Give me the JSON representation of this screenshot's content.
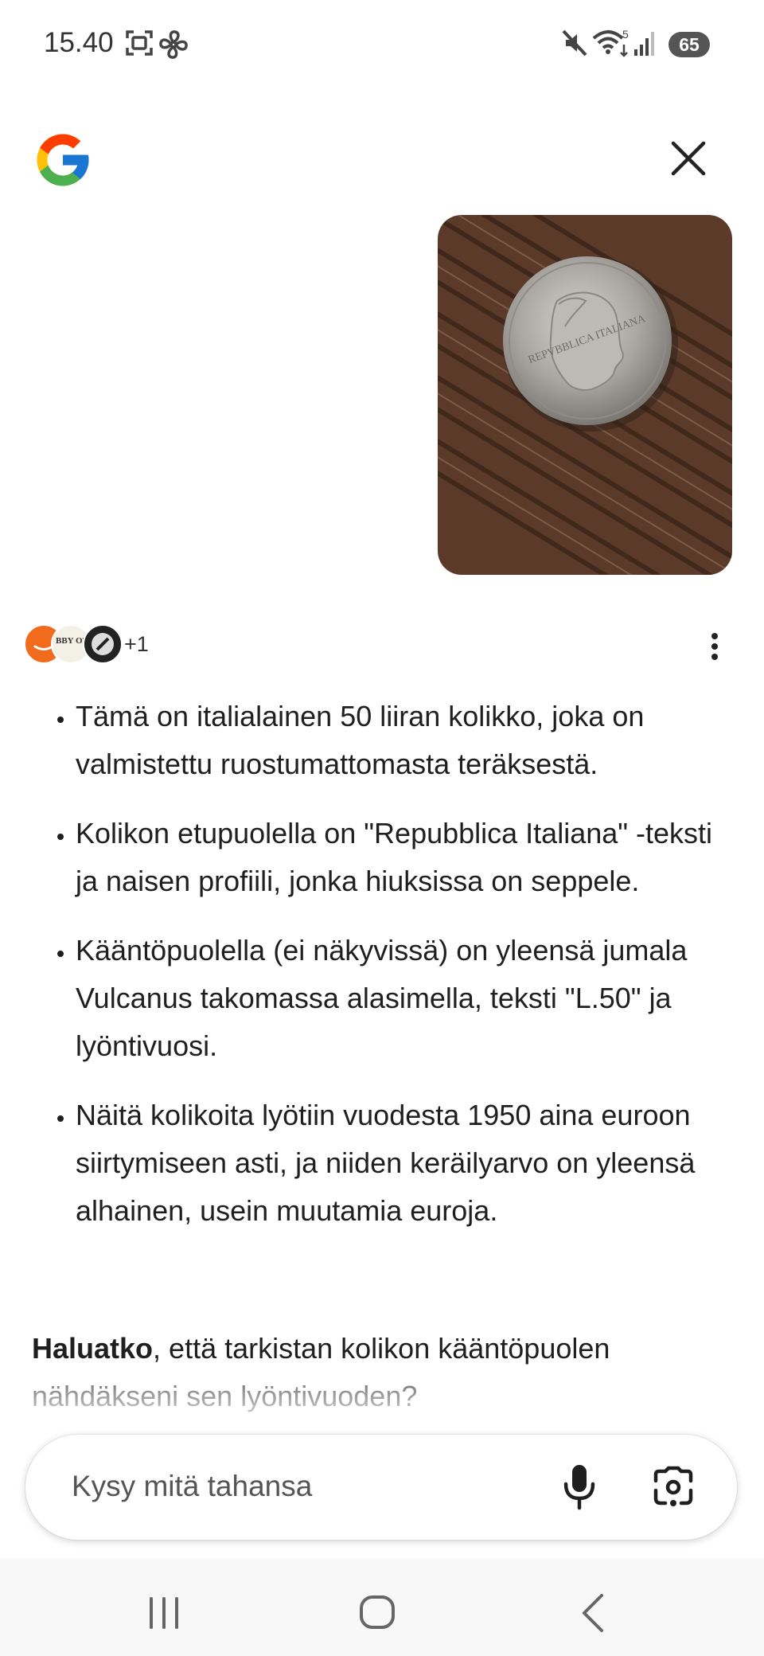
{
  "status_bar": {
    "time": "15.40",
    "battery": "65",
    "icons_left": [
      "screenshot-icon",
      "fan-icon"
    ],
    "icons_right": [
      "mute-icon",
      "wifi-icon",
      "signal-icon"
    ],
    "wifi_label": "5"
  },
  "header": {
    "logo": "google-logo",
    "close_icon": "close-icon"
  },
  "query_image": {
    "description_icon": "coin-photo",
    "coin_legend": "REPVBBLICA ITALIANA"
  },
  "sources": {
    "icons": [
      "amazon-source-icon",
      "hobby-of-kings-source-icon",
      "coin-source-icon"
    ],
    "hobby_logo_text": "BBY OF NGS",
    "more_count": "+1"
  },
  "answer": {
    "bullets": [
      "Tämä on italialainen 50 liiran kolikko, joka on valmistettu ruostumattomasta teräksestä.",
      "Kolikon etupuolella on \"Repubblica Italiana\" -teksti ja naisen profiili, jonka hiuksissa on seppele.",
      "Kääntöpuolella (ei näkyvissä) on yleensä jumala Vulcanus takomassa alasimella, teksti \"L.50\" ja lyöntivuosi.",
      "Näitä kolikoita lyötiin vuodesta 1950 aina euroon siirtymiseen asti, ja niiden keräilyarvo on yleensä alhainen, usein muutamia euroja."
    ],
    "followup_bold": "Haluatko",
    "followup_rest": ", että tarkistan kolikon kääntöpuolen nähdäkseni sen lyöntivuoden?"
  },
  "input": {
    "placeholder": "Kysy mitä tahansa",
    "mic_icon": "mic-icon",
    "lens_icon": "lens-icon"
  },
  "nav": {
    "icons": [
      "recent-apps-icon",
      "home-icon",
      "back-icon"
    ]
  }
}
